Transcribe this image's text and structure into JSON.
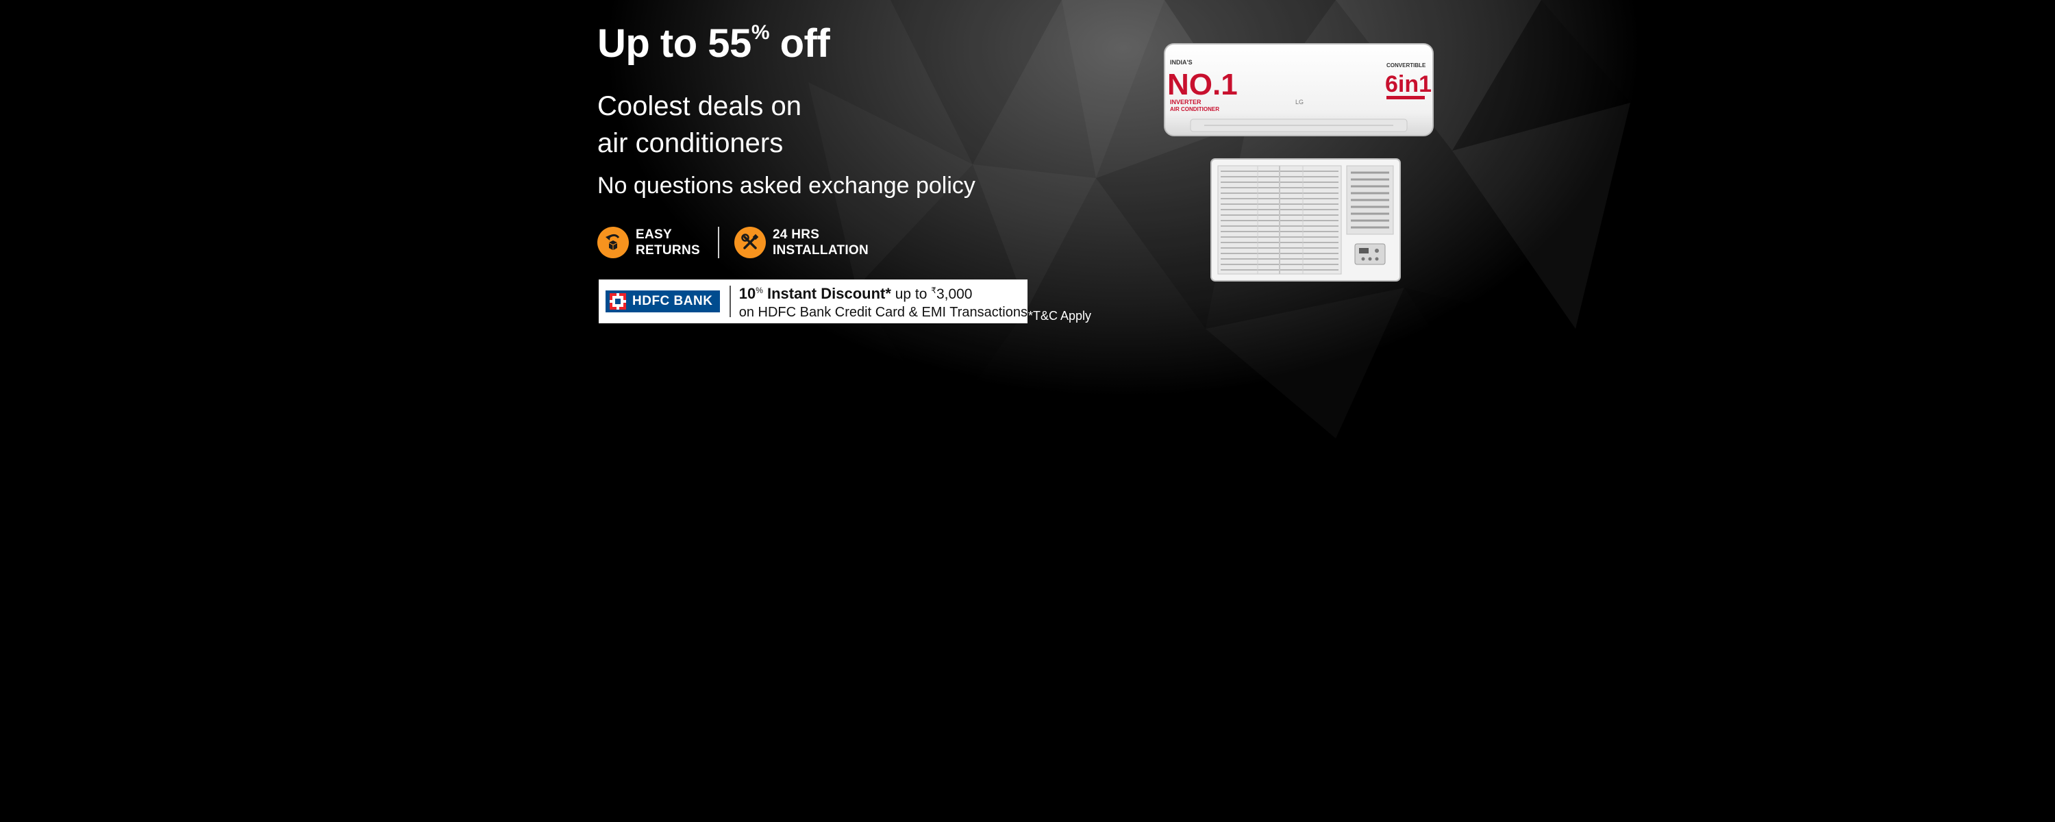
{
  "headline": {
    "prefix": "Up to 55",
    "superscript": "%",
    "suffix": " off"
  },
  "subhead": {
    "line1": "Coolest deals on",
    "line2": "air conditioners"
  },
  "policy": "No questions asked exchange policy",
  "features": [
    {
      "line1": "EASY",
      "line2": "RETURNS",
      "icon": "box-return-icon"
    },
    {
      "line1": "24 HRS",
      "line2": "INSTALLATION",
      "icon": "tools-icon"
    }
  ],
  "bank_offer": {
    "bank_name": "HDFC BANK",
    "discount_value": "10",
    "discount_unit": "%",
    "discount_label": " Instant Discount*",
    "upto_text": " up to ",
    "currency_symbol": "₹",
    "amount": "3,000",
    "line2": "on HDFC Bank Credit Card & EMI Transactions"
  },
  "tnc": "*T&C Apply",
  "split_ac": {
    "badge_left_top": "INDIA'S",
    "badge_left_big": "NO.1",
    "badge_left_bottom1": "INVERTER",
    "badge_left_bottom2": "AIR CONDITIONER",
    "badge_right_top": "CONVERTIBLE",
    "badge_right_big": "6in1",
    "brand": "LG"
  },
  "colors": {
    "accent_orange": "#f7931e",
    "hdfc_blue": "#004c8f",
    "hdfc_red": "#ed232a",
    "badge_red": "#c8102e"
  }
}
